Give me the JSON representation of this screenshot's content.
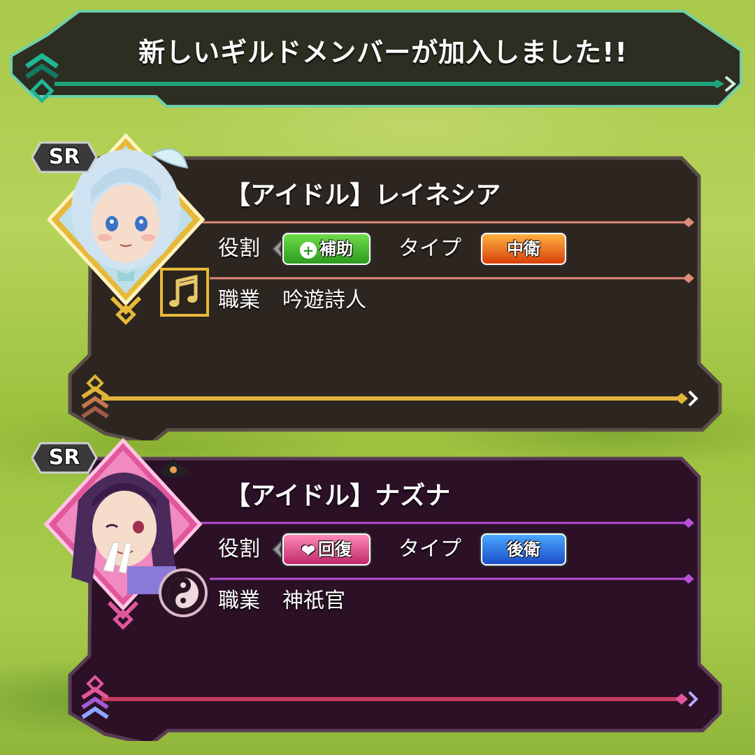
{
  "banner": {
    "title": "新しいギルドメンバーが加入しました!!"
  },
  "members": [
    {
      "rarity": "SR",
      "name": "【アイドル】レイネシア",
      "role_label": "役割",
      "role": "補助",
      "type_label": "タイプ",
      "type": "中衛",
      "job_label": "職業",
      "job": "吟遊詩人",
      "job_icon": "music-note-icon",
      "colors": {
        "panel": "#2d2620",
        "accent": "#e7b93a",
        "line": "#e08a78",
        "role_chip": "#3daa2c",
        "type_chip": "#e25a12"
      }
    },
    {
      "rarity": "SR",
      "name": "【アイドル】ナズナ",
      "role_label": "役割",
      "role": "回復",
      "type_label": "タイプ",
      "type": "後衛",
      "job_label": "職業",
      "job": "神祇官",
      "job_icon": "yin-yang-icon",
      "colors": {
        "panel": "#2b1026",
        "accent": "#e2569c",
        "line": "#b84fd6",
        "role_chip": "#d5407a",
        "type_chip": "#1e6ee0"
      }
    }
  ]
}
